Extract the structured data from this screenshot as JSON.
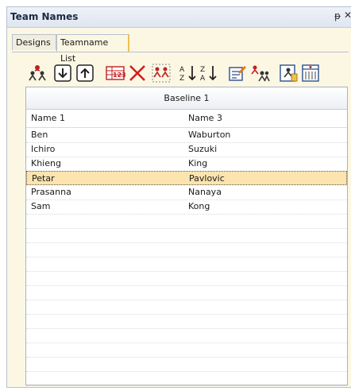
{
  "panel": {
    "title": "Team Names",
    "pin_icon": "pin-icon",
    "close_icon": "close-icon"
  },
  "tabs": [
    {
      "label": "Designs",
      "active": false
    },
    {
      "label": "Teamname List",
      "active": true
    }
  ],
  "toolbar": {
    "buttons": [
      {
        "name": "add-team-icon"
      },
      {
        "name": "move-down-icon"
      },
      {
        "name": "move-up-icon"
      },
      {
        "name": "numbering-icon"
      },
      {
        "name": "delete-icon"
      },
      {
        "name": "select-team-icon"
      },
      {
        "name": "sort-ascending-icon"
      },
      {
        "name": "sort-descending-icon"
      },
      {
        "name": "edit-note-icon"
      },
      {
        "name": "assign-team-icon"
      },
      {
        "name": "import-icon"
      },
      {
        "name": "export-icon"
      }
    ]
  },
  "grid": {
    "group_header": "Baseline 1",
    "columns": [
      "Name 1",
      "Name 3"
    ],
    "rows": [
      [
        "Ben",
        "Waburton"
      ],
      [
        "Ichiro",
        "Suzuki"
      ],
      [
        "Khieng",
        "King"
      ],
      [
        "Petar",
        "Pavlovic"
      ],
      [
        "Prasanna",
        "Nanaya"
      ],
      [
        "Sam",
        "Kong"
      ]
    ],
    "selected_row": 3,
    "empty_rows": 12
  },
  "colors": {
    "accent": "#f0c050",
    "selection": "#fbe4ae",
    "panel_bg": "#fbf7e3"
  }
}
